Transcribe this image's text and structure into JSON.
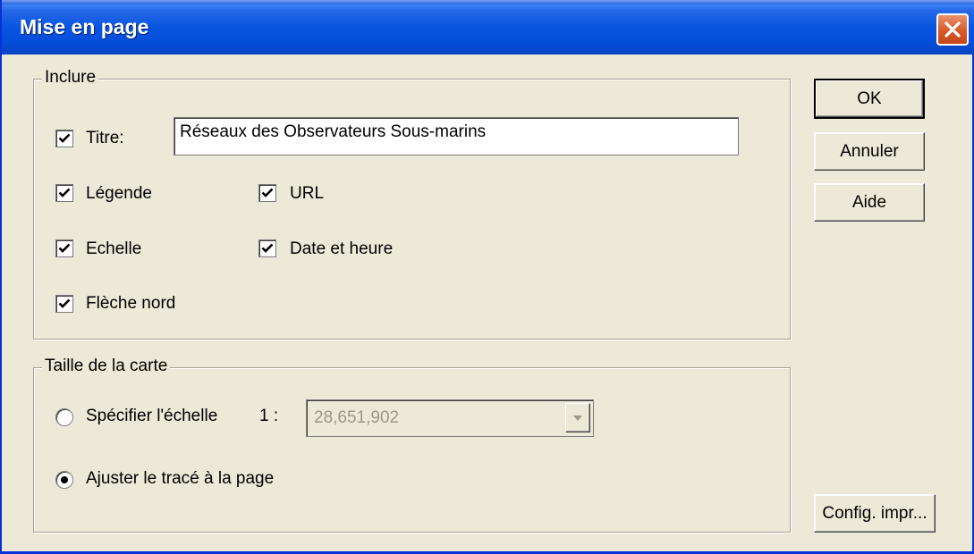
{
  "window": {
    "title": "Mise en page"
  },
  "include_group": {
    "legend": "Inclure",
    "title_checkbox": {
      "label": "Titre:",
      "checked": true
    },
    "title_input": {
      "value": "Réseaux des Observateurs Sous-marins"
    },
    "legend_checkbox": {
      "label": "Légende",
      "checked": true
    },
    "url_checkbox": {
      "label": "URL",
      "checked": true
    },
    "scale_checkbox": {
      "label": "Echelle",
      "checked": true
    },
    "datetime_checkbox": {
      "label": "Date et heure",
      "checked": true
    },
    "north_arrow_checkbox": {
      "label": "Flèche nord",
      "checked": true
    }
  },
  "map_size_group": {
    "legend": "Taille de la carte",
    "specify_scale_radio": {
      "label": "Spécifier l'échelle",
      "selected": false
    },
    "ratio_prefix": "1 :",
    "scale_combo": {
      "value": "28,651,902",
      "disabled": true
    },
    "fit_to_page_radio": {
      "label": "Ajuster le tracé à la page",
      "selected": true
    }
  },
  "buttons": {
    "ok": "OK",
    "cancel": "Annuler",
    "help": "Aide",
    "print_setup": "Config. impr..."
  },
  "colors": {
    "titlebar": "#0450dc",
    "dialog_background": "#ece9d8",
    "close_button": "#d85a2a"
  }
}
